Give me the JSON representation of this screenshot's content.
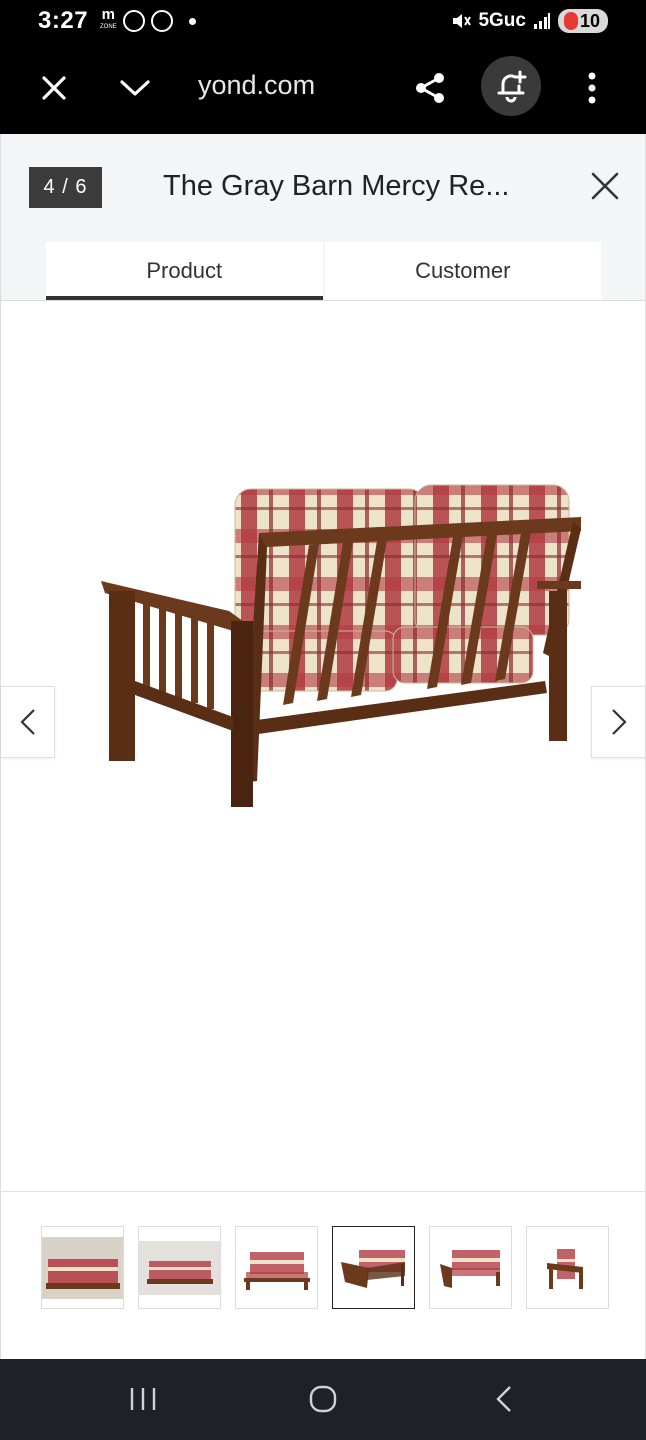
{
  "status_bar": {
    "time": "3:27",
    "mzone_top": "m",
    "mzone_bottom": "ZONE",
    "network": "5Guc",
    "battery": "10",
    "icons": [
      "mzone-icon",
      "threads-icon",
      "basketball-icon",
      "notification-dot-icon",
      "mute-icon",
      "signal-icon",
      "battery-icon"
    ]
  },
  "browser": {
    "url": "yond.com",
    "icons": [
      "close-icon",
      "chevron-down-icon",
      "share-icon",
      "bell-plus-icon",
      "more-vert-icon"
    ]
  },
  "viewer": {
    "counter": "4 / 6",
    "title": "The Gray Barn Mercy Re...",
    "tabs": [
      {
        "label": "Product",
        "active": true
      },
      {
        "label": "Customer",
        "active": false
      }
    ],
    "selected_thumbnail": 4,
    "thumbnail_count": 6
  },
  "colors": {
    "wood": "#6b3a1c",
    "wood_dark": "#4a2410",
    "plaid_red": "#b23a42",
    "plaid_cream": "#ede3c8",
    "accent_dark": "#333333"
  },
  "system_nav": {
    "icons": [
      "recent-apps-icon",
      "home-icon",
      "back-icon"
    ]
  }
}
